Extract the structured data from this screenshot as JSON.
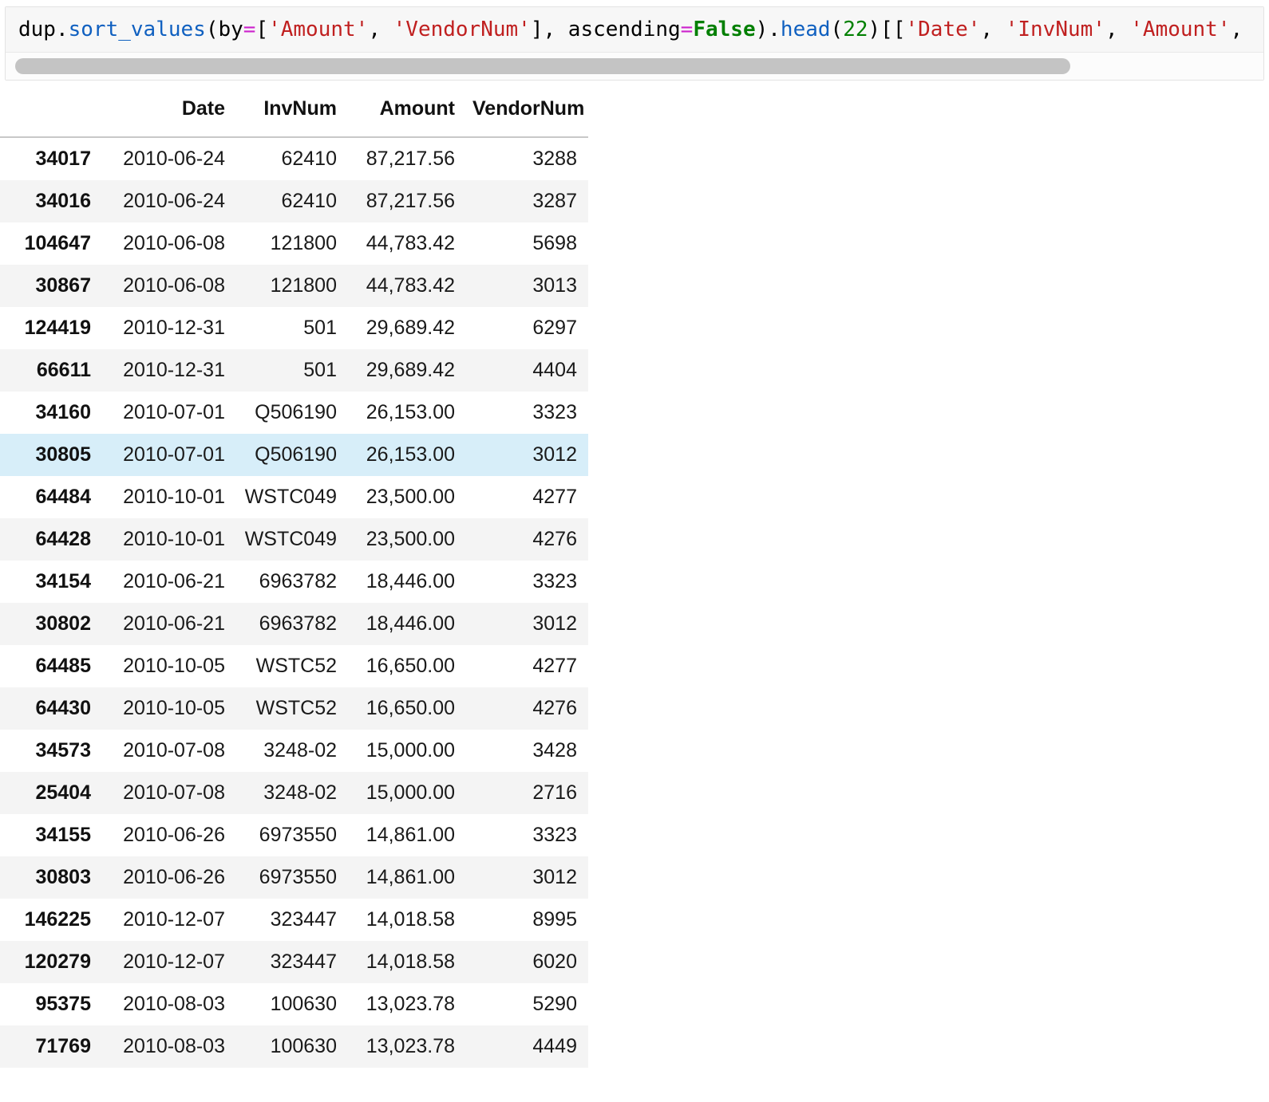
{
  "code_cell": {
    "tokens": [
      {
        "t": "dup",
        "k": "name"
      },
      {
        "t": ".",
        "k": "punct"
      },
      {
        "t": "sort_values",
        "k": "fn"
      },
      {
        "t": "(by",
        "k": "punct"
      },
      {
        "t": "=",
        "k": "op"
      },
      {
        "t": "[",
        "k": "punct"
      },
      {
        "t": "'Amount'",
        "k": "str"
      },
      {
        "t": ", ",
        "k": "punct"
      },
      {
        "t": "'VendorNum'",
        "k": "str"
      },
      {
        "t": "], ascending",
        "k": "punct"
      },
      {
        "t": "=",
        "k": "op"
      },
      {
        "t": "False",
        "k": "bool"
      },
      {
        "t": ").",
        "k": "punct"
      },
      {
        "t": "head",
        "k": "fn"
      },
      {
        "t": "(",
        "k": "punct"
      },
      {
        "t": "22",
        "k": "num"
      },
      {
        "t": ")[[",
        "k": "punct"
      },
      {
        "t": "'Date'",
        "k": "str"
      },
      {
        "t": ", ",
        "k": "punct"
      },
      {
        "t": "'InvNum'",
        "k": "str"
      },
      {
        "t": ", ",
        "k": "punct"
      },
      {
        "t": "'Amount'",
        "k": "str"
      },
      {
        "t": ",",
        "k": "punct"
      }
    ],
    "plain_text": "dup.sort_values(by=['Amount', 'VendorNum'], ascending=False).head(22)[['Date', 'InvNum', 'Amount',",
    "scrollbar": {
      "name": "horizontal-scrollbar"
    }
  },
  "table": {
    "index_header": "",
    "columns": [
      "Date",
      "InvNum",
      "Amount",
      "VendorNum"
    ],
    "rows": [
      {
        "index": "34017",
        "Date": "2010-06-24",
        "InvNum": "62410",
        "Amount": "87,217.56",
        "VendorNum": "3288",
        "highlighted": false
      },
      {
        "index": "34016",
        "Date": "2010-06-24",
        "InvNum": "62410",
        "Amount": "87,217.56",
        "VendorNum": "3287",
        "highlighted": false
      },
      {
        "index": "104647",
        "Date": "2010-06-08",
        "InvNum": "121800",
        "Amount": "44,783.42",
        "VendorNum": "5698",
        "highlighted": false
      },
      {
        "index": "30867",
        "Date": "2010-06-08",
        "InvNum": "121800",
        "Amount": "44,783.42",
        "VendorNum": "3013",
        "highlighted": false
      },
      {
        "index": "124419",
        "Date": "2010-12-31",
        "InvNum": "501",
        "Amount": "29,689.42",
        "VendorNum": "6297",
        "highlighted": false
      },
      {
        "index": "66611",
        "Date": "2010-12-31",
        "InvNum": "501",
        "Amount": "29,689.42",
        "VendorNum": "4404",
        "highlighted": false
      },
      {
        "index": "34160",
        "Date": "2010-07-01",
        "InvNum": "Q506190",
        "Amount": "26,153.00",
        "VendorNum": "3323",
        "highlighted": false
      },
      {
        "index": "30805",
        "Date": "2010-07-01",
        "InvNum": "Q506190",
        "Amount": "26,153.00",
        "VendorNum": "3012",
        "highlighted": true
      },
      {
        "index": "64484",
        "Date": "2010-10-01",
        "InvNum": "WSTC049",
        "Amount": "23,500.00",
        "VendorNum": "4277",
        "highlighted": false
      },
      {
        "index": "64428",
        "Date": "2010-10-01",
        "InvNum": "WSTC049",
        "Amount": "23,500.00",
        "VendorNum": "4276",
        "highlighted": false
      },
      {
        "index": "34154",
        "Date": "2010-06-21",
        "InvNum": "6963782",
        "Amount": "18,446.00",
        "VendorNum": "3323",
        "highlighted": false
      },
      {
        "index": "30802",
        "Date": "2010-06-21",
        "InvNum": "6963782",
        "Amount": "18,446.00",
        "VendorNum": "3012",
        "highlighted": false
      },
      {
        "index": "64485",
        "Date": "2010-10-05",
        "InvNum": "WSTC52",
        "Amount": "16,650.00",
        "VendorNum": "4277",
        "highlighted": false
      },
      {
        "index": "64430",
        "Date": "2010-10-05",
        "InvNum": "WSTC52",
        "Amount": "16,650.00",
        "VendorNum": "4276",
        "highlighted": false
      },
      {
        "index": "34573",
        "Date": "2010-07-08",
        "InvNum": "3248-02",
        "Amount": "15,000.00",
        "VendorNum": "3428",
        "highlighted": false
      },
      {
        "index": "25404",
        "Date": "2010-07-08",
        "InvNum": "3248-02",
        "Amount": "15,000.00",
        "VendorNum": "2716",
        "highlighted": false
      },
      {
        "index": "34155",
        "Date": "2010-06-26",
        "InvNum": "6973550",
        "Amount": "14,861.00",
        "VendorNum": "3323",
        "highlighted": false
      },
      {
        "index": "30803",
        "Date": "2010-06-26",
        "InvNum": "6973550",
        "Amount": "14,861.00",
        "VendorNum": "3012",
        "highlighted": false
      },
      {
        "index": "146225",
        "Date": "2010-12-07",
        "InvNum": "323447",
        "Amount": "14,018.58",
        "VendorNum": "8995",
        "highlighted": false
      },
      {
        "index": "120279",
        "Date": "2010-12-07",
        "InvNum": "323447",
        "Amount": "14,018.58",
        "VendorNum": "6020",
        "highlighted": false
      },
      {
        "index": "95375",
        "Date": "2010-08-03",
        "InvNum": "100630",
        "Amount": "13,023.78",
        "VendorNum": "5290",
        "highlighted": false
      },
      {
        "index": "71769",
        "Date": "2010-08-03",
        "InvNum": "100630",
        "Amount": "13,023.78",
        "VendorNum": "4449",
        "highlighted": false
      }
    ]
  },
  "colors": {
    "code_bg": "#f7f7f7",
    "stripe": "#f4f4f4",
    "highlight_row": "#d7eef9",
    "string_token": "#c02020",
    "function_token": "#1060c0",
    "operator_token": "#cc22cc",
    "boolean_token": "#007f00",
    "number_token": "#008000",
    "scrollbar_thumb": "#c4c4c4"
  }
}
